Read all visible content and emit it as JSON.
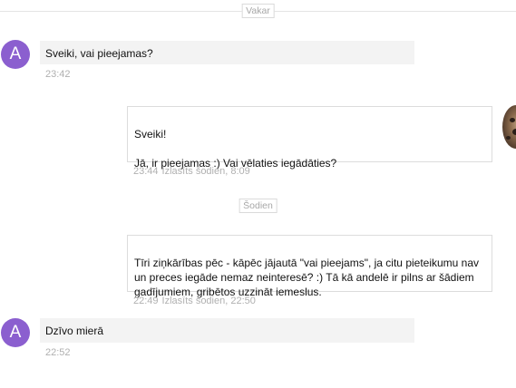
{
  "date_separators": {
    "yesterday": "Vakar",
    "today": "Šodien"
  },
  "messages": [
    {
      "direction": "incoming",
      "avatar_letter": "A",
      "text": "Sveiki, vai pieejamas?",
      "time": "23:42"
    },
    {
      "direction": "outgoing",
      "text": "Sveiki!\n\nJā, ir pieejamas :) Vai vēlaties iegādāties?",
      "time": "23:44",
      "read_status": "Izlasīts šodien, 8:09"
    },
    {
      "direction": "outgoing",
      "text": "Tīri ziņkārības pēc - kāpēc jājautā \"vai pieejams\", ja citu pieteikumu nav un preces iegāde nemaz neinteresē? :) Tā kā andelē ir pilns ar šādiem gadījumiem, gribētos uzzināt iemeslus.",
      "time": "22:49",
      "read_status": "Izlasīts šodien, 22:50"
    },
    {
      "direction": "incoming",
      "avatar_letter": "A",
      "text": "Dzīvo mierā",
      "time": "22:52"
    }
  ],
  "colors": {
    "avatar_bg": "#8b5fcf",
    "incoming_bg": "#f3f3f3",
    "outgoing_border": "#dcdcdc",
    "meta_text": "#b0b0b0"
  }
}
